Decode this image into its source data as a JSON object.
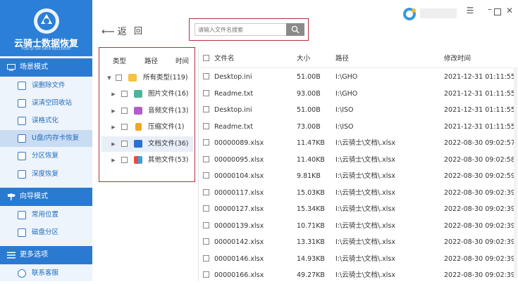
{
  "app": {
    "logo_title": "云骑士数据恢复",
    "logo_subtitle": "YUN QI SHI DATA RECOVERY"
  },
  "sidebar": {
    "sections": [
      {
        "label": "场景模式",
        "items": [
          "误删除文件",
          "误清空回收站",
          "误格式化",
          "U盘/内存卡恢复",
          "分区恢复",
          "深度恢复"
        ]
      },
      {
        "label": "向导模式",
        "items": [
          "常用位置",
          "磁盘分区"
        ]
      },
      {
        "label": "更多选项",
        "items": [
          "联系客服"
        ]
      }
    ]
  },
  "toolbar": {
    "back_label": "返",
    "home_label": "回",
    "search_placeholder": "请输入文件名搜索"
  },
  "tree": {
    "headers": [
      "类型",
      "路径",
      "时间"
    ],
    "items": [
      {
        "label": "所有类型(119)",
        "icon": "folder-icon"
      },
      {
        "label": "图片文件(16)",
        "icon": "image-icon"
      },
      {
        "label": "音频文件(13)",
        "icon": "audio-icon"
      },
      {
        "label": "压缩文件(1)",
        "icon": "zip-icon"
      },
      {
        "label": "文档文件(36)",
        "icon": "document-icon"
      },
      {
        "label": "其他文件(53)",
        "icon": "other-icon"
      }
    ]
  },
  "table": {
    "headers": [
      "文件名",
      "大小",
      "路径",
      "修改时间"
    ],
    "rows": [
      [
        "Desktop.ini",
        "51.00B",
        "I:\\GHO",
        "2021-12-31 01:11:55"
      ],
      [
        "Readme.txt",
        "93.00B",
        "I:\\GHO",
        "2021-12-31 01:11:55"
      ],
      [
        "Desktop.ini",
        "51.00B",
        "I:\\ISO",
        "2021-12-31 01:11:55"
      ],
      [
        "Readme.txt",
        "73.00B",
        "I:\\ISO",
        "2021-12-31 01:11:55"
      ],
      [
        "00000089.xlsx",
        "11.47KB",
        "I:\\云骑士\\文档\\.xlsx",
        "2022-08-30 09:02:57"
      ],
      [
        "00000095.xlsx",
        "11.40KB",
        "I:\\云骑士\\文档\\.xlsx",
        "2022-08-30 09:02:58"
      ],
      [
        "00000104.xlsx",
        "9.81KB",
        "I:\\云骑士\\文档\\.xlsx",
        "2022-08-30 09:02:59"
      ],
      [
        "00000117.xlsx",
        "15.03KB",
        "I:\\云骑士\\文档\\.xlsx",
        "2022-08-30 09:02:39"
      ],
      [
        "00000127.xlsx",
        "15.34KB",
        "I:\\云骑士\\文档\\.xlsx",
        "2022-08-30 09:02:39"
      ],
      [
        "00000139.xlsx",
        "10.71KB",
        "I:\\云骑士\\文档\\.xlsx",
        "2022-08-30 09:02:39"
      ],
      [
        "00000142.xlsx",
        "13.31KB",
        "I:\\云骑士\\文档\\.xlsx",
        "2022-08-30 09:02:39"
      ],
      [
        "00000146.xlsx",
        "14.93KB",
        "I:\\云骑士\\文档\\.xlsx",
        "2022-08-30 09:02:39"
      ],
      [
        "00000166.xlsx",
        "49.27KB",
        "I:\\云骑士\\文档\\.xlsx",
        "2022-08-30 09:02:39"
      ]
    ]
  },
  "colors": {
    "brand": "#2b7ad2",
    "highlight": "#c9dcf2",
    "annotation": "#b3303a"
  }
}
